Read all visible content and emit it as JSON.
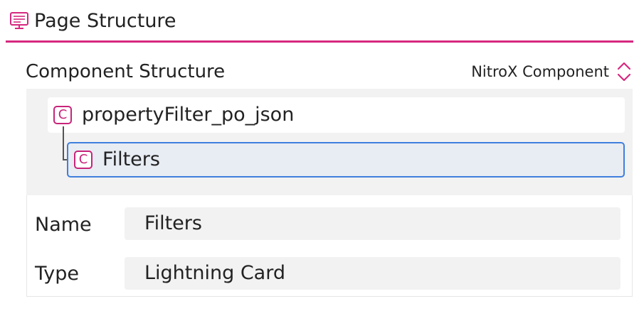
{
  "header": {
    "title": "Page Structure",
    "icon": "monitor-icon"
  },
  "section": {
    "title": "Component Structure"
  },
  "type_select": {
    "label": "NitroX Component",
    "icon": "chevron-up-down-icon"
  },
  "tree": {
    "badge": "C",
    "root": {
      "label": "propertyFilter_po_json"
    },
    "child": {
      "label": "Filters",
      "selected": true
    }
  },
  "properties": {
    "name": {
      "label": "Name",
      "value": "Filters"
    },
    "type": {
      "label": "Type",
      "value": "Lightning Card"
    }
  },
  "colors": {
    "accent": "#d6287f",
    "badge": "#c7247a",
    "selection_border": "#3f7fde",
    "selection_bg": "#e8ecf3"
  }
}
